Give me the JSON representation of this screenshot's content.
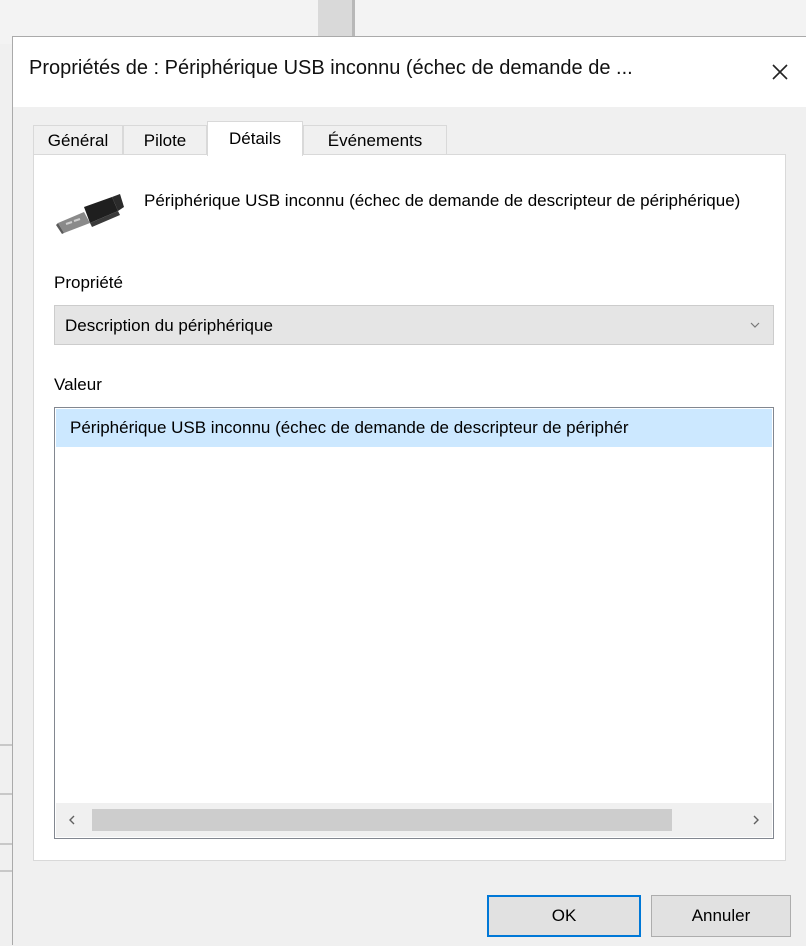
{
  "window": {
    "title": "Propriétés de : Périphérique USB inconnu (échec de demande de ..."
  },
  "tabs": [
    {
      "label": "Général",
      "active": false
    },
    {
      "label": "Pilote",
      "active": false
    },
    {
      "label": "Détails",
      "active": true
    },
    {
      "label": "Événements",
      "active": false
    }
  ],
  "device": {
    "icon": "usb-icon",
    "name": "Périphérique USB inconnu (échec de demande de descripteur de périphérique)"
  },
  "property": {
    "label": "Propriété",
    "selected": "Description du périphérique"
  },
  "value": {
    "label": "Valeur",
    "items": [
      "Périphérique USB inconnu (échec de demande de descripteur de périphér"
    ]
  },
  "buttons": {
    "ok": "OK",
    "cancel": "Annuler"
  },
  "colors": {
    "selection": "#cce8ff",
    "default_button_border": "#0078d7"
  }
}
